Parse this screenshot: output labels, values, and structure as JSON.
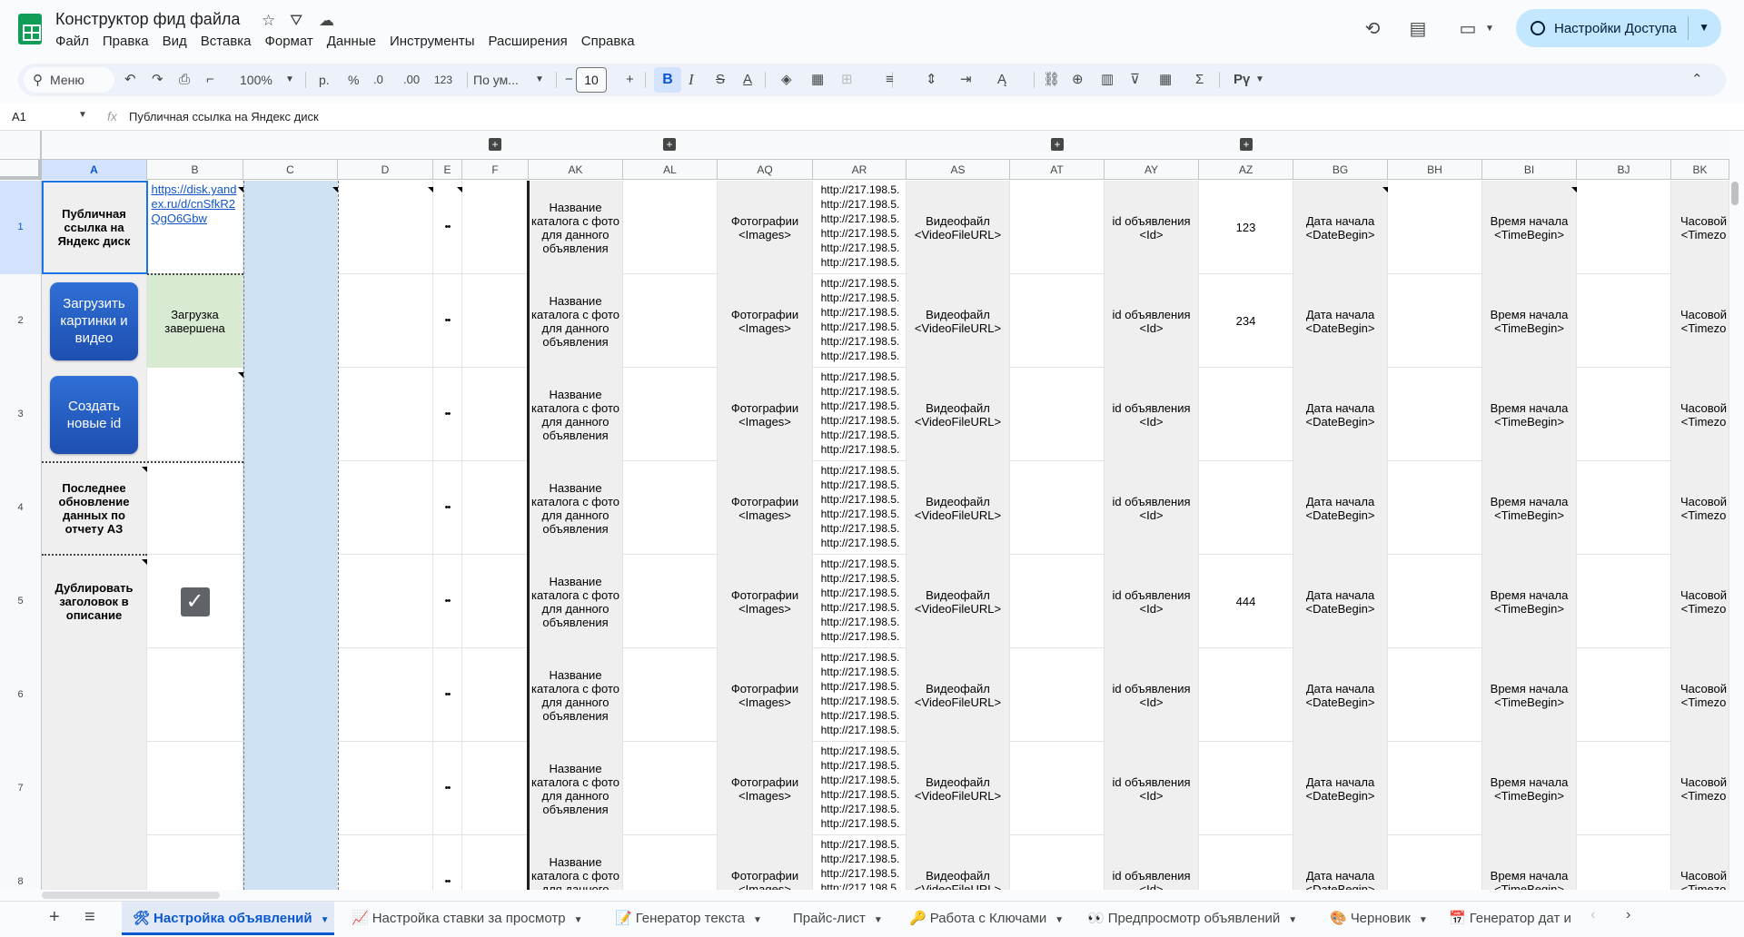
{
  "app": {
    "title": "Конструктор фид файла",
    "menu": [
      "Файл",
      "Правка",
      "Вид",
      "Вставка",
      "Формат",
      "Данные",
      "Инструменты",
      "Расширения",
      "Справка"
    ],
    "share_label": "Настройки Доступа"
  },
  "toolbar": {
    "search_label": "Меню",
    "zoom": "100%",
    "currency": "р.",
    "percent": "%",
    "dec_less": ".0",
    "dec_more": ".00",
    "number_format": "123",
    "font": "По ум...",
    "font_size": "10",
    "bold": "B",
    "italic": "I",
    "strike": "S",
    "text_color": "A",
    "sum": "Σ",
    "lang": "Рү"
  },
  "formula_bar": {
    "cell_ref": "A1",
    "fx": "fx",
    "content": "Публичная ссылка на Яндекс диск"
  },
  "columns": [
    "A",
    "B",
    "C",
    "D",
    "E",
    "F",
    "AK",
    "AL",
    "AQ",
    "AR",
    "AS",
    "AT",
    "AY",
    "AZ",
    "BG",
    "BH",
    "BI",
    "BJ",
    "BK"
  ],
  "rows": [
    "1",
    "2",
    "3",
    "4",
    "5",
    "6",
    "7",
    "8"
  ],
  "cells": {
    "a1": "Публичная ссылка на Яндекс диск",
    "b1": "https://disk.yandex.ru/d/cnSfkR2QgO6Gbw",
    "a2_button": "Загрузить картинки и видео",
    "b2": "Загрузка завершена",
    "a3_button": "Создать новые id",
    "a4": "Последнее обновление данных по отчету АЗ",
    "a5": "Дублировать заголовок в описание",
    "e": "••",
    "ak": "Название каталога с фото для данного объявления",
    "aq": "Фотографии <Images>",
    "ar": "http://217.198.5.",
    "as": "Видеофайл <VideoFileURL>",
    "ay": "id объявления <Id>",
    "az": [
      "123",
      "234",
      "",
      "",
      "444",
      "",
      "",
      ""
    ],
    "bg": "Дата начала <DateBegin>",
    "bi": "Время начала <TimeBegin>",
    "bk": "Часовой <Timezo"
  },
  "tabs": [
    {
      "icon": "🛠",
      "label": "Настройка объявлений",
      "active": true
    },
    {
      "icon": "📈",
      "label": "Настройка ставки за просмотр",
      "active": false
    },
    {
      "icon": "📝",
      "label": "Генератор текста",
      "active": false
    },
    {
      "icon": "",
      "label": "Прайс-лист",
      "active": false
    },
    {
      "icon": "🔑",
      "label": "Работа с Ключами",
      "active": false
    },
    {
      "icon": "👀",
      "label": "Предпросмотр объявлений",
      "active": false
    },
    {
      "icon": "🎨",
      "label": "Черновик",
      "active": false
    },
    {
      "icon": "📅",
      "label": "Генератор дат и",
      "active": false
    }
  ],
  "colors": {
    "accent": "#0b57d0",
    "selection": "#d3e3fd",
    "share": "#c2e7ff",
    "button_blue": "#1e4fb0",
    "green_cell": "#d9ead3",
    "blue_col": "#cfe2f3",
    "gray_col": "#efefef"
  },
  "icons": [
    "sheets-logo-icon",
    "star-icon",
    "move-to-drive-icon",
    "cloud-icon",
    "history-icon",
    "comment-icon",
    "meet-icon",
    "globe-icon"
  ]
}
